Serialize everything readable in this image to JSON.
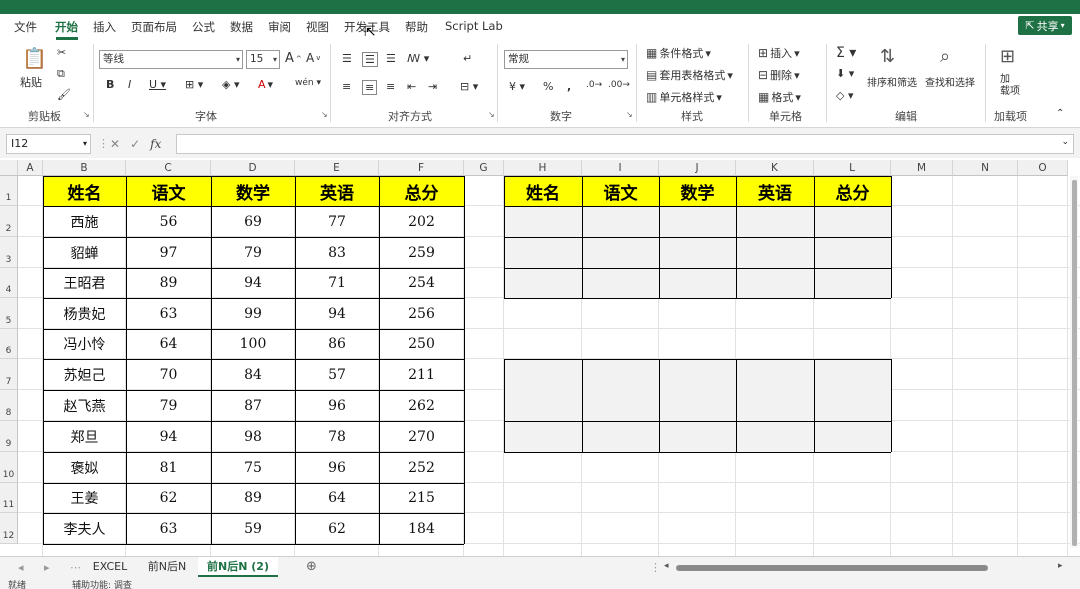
{
  "menu": [
    "文件",
    "开始",
    "插入",
    "页面布局",
    "公式",
    "数据",
    "审阅",
    "视图",
    "开发工具",
    "帮助",
    "Script Lab"
  ],
  "share_label": "共享",
  "ribbon": {
    "paste": "粘贴",
    "font_name": "等线",
    "font_size": "15",
    "number_format": "常规",
    "conditional_format": "条件格式",
    "table_format": "套用表格格式",
    "cell_style": "单元格样式",
    "insert": "插入",
    "delete": "删除",
    "format": "格式",
    "sort_filter": "排序和筛选",
    "find_select": "查找和选择",
    "addins": "加\n载项",
    "groups": [
      "剪贴板",
      "字体",
      "对齐方式",
      "数字",
      "样式",
      "单元格",
      "编辑",
      "加载项"
    ]
  },
  "namebox": "I12",
  "fx": "fx",
  "columns": [
    "A",
    "B",
    "C",
    "D",
    "E",
    "F",
    "G",
    "H",
    "I",
    "J",
    "K",
    "L",
    "M",
    "N",
    "O"
  ],
  "rows": [
    "1",
    "2",
    "3",
    "4",
    "5",
    "6",
    "7",
    "8",
    "9",
    "10",
    "11",
    "12"
  ],
  "table": {
    "headers": [
      "姓名",
      "语文",
      "数学",
      "英语",
      "总分"
    ],
    "rows": [
      [
        "西施",
        "56",
        "69",
        "77",
        "202"
      ],
      [
        "貂蝉",
        "97",
        "79",
        "83",
        "259"
      ],
      [
        "王昭君",
        "89",
        "94",
        "71",
        "254"
      ],
      [
        "杨贵妃",
        "63",
        "99",
        "94",
        "256"
      ],
      [
        "冯小怜",
        "64",
        "100",
        "86",
        "250"
      ],
      [
        "苏妲己",
        "70",
        "84",
        "57",
        "211"
      ],
      [
        "赵飞燕",
        "79",
        "87",
        "96",
        "262"
      ],
      [
        "郑旦",
        "94",
        "98",
        "78",
        "270"
      ],
      [
        "褒姒",
        "81",
        "75",
        "96",
        "252"
      ],
      [
        "王姜",
        "62",
        "89",
        "64",
        "215"
      ],
      [
        "李夫人",
        "63",
        "59",
        "62",
        "184"
      ]
    ]
  },
  "result_headers": [
    "姓名",
    "语文",
    "数学",
    "英语",
    "总分"
  ],
  "sheet_tabs": [
    "EXCEL",
    "前N后N",
    "前N后N (2)"
  ],
  "status": [
    "就绪",
    "辅助功能: 调查"
  ]
}
